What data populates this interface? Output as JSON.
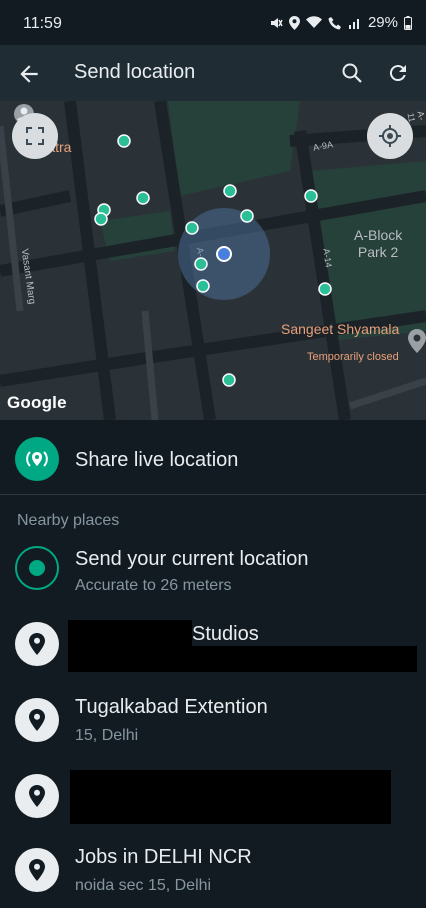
{
  "status_bar": {
    "time": "11:59",
    "battery": "29%"
  },
  "app_bar": {
    "title": "Send location",
    "back_icon": "arrow-left-icon",
    "search_icon": "search-icon",
    "refresh_icon": "refresh-icon"
  },
  "map": {
    "labels": {
      "batra": "Batra",
      "a9a": "A-9A",
      "a11": "A-11",
      "park": "A-Block\nPark 2",
      "vasant": "Vasant Marg",
      "a14": "A-14",
      "a_small": "A-",
      "sangeet": "Sangeet Shyamala",
      "closed": "Temporarily closed"
    },
    "google": "Google",
    "accent_color": "#00a884",
    "poi_color": "#2bbf98",
    "user_dot_color": "#4a7fe0"
  },
  "share_live": {
    "label": "Share live location",
    "icon": "live-location-icon"
  },
  "nearby": {
    "title": "Nearby places",
    "current": {
      "name": "Send your current location",
      "sub": "Accurate to 26 meters"
    },
    "places": [
      {
        "name": "Studios",
        "sub": ""
      },
      {
        "name": "Tugalkabad Extention",
        "sub": "15, Delhi"
      },
      {
        "name": "",
        "sub": ""
      },
      {
        "name": "Jobs in DELHI NCR",
        "sub": "noida sec 15, Delhi"
      }
    ]
  }
}
